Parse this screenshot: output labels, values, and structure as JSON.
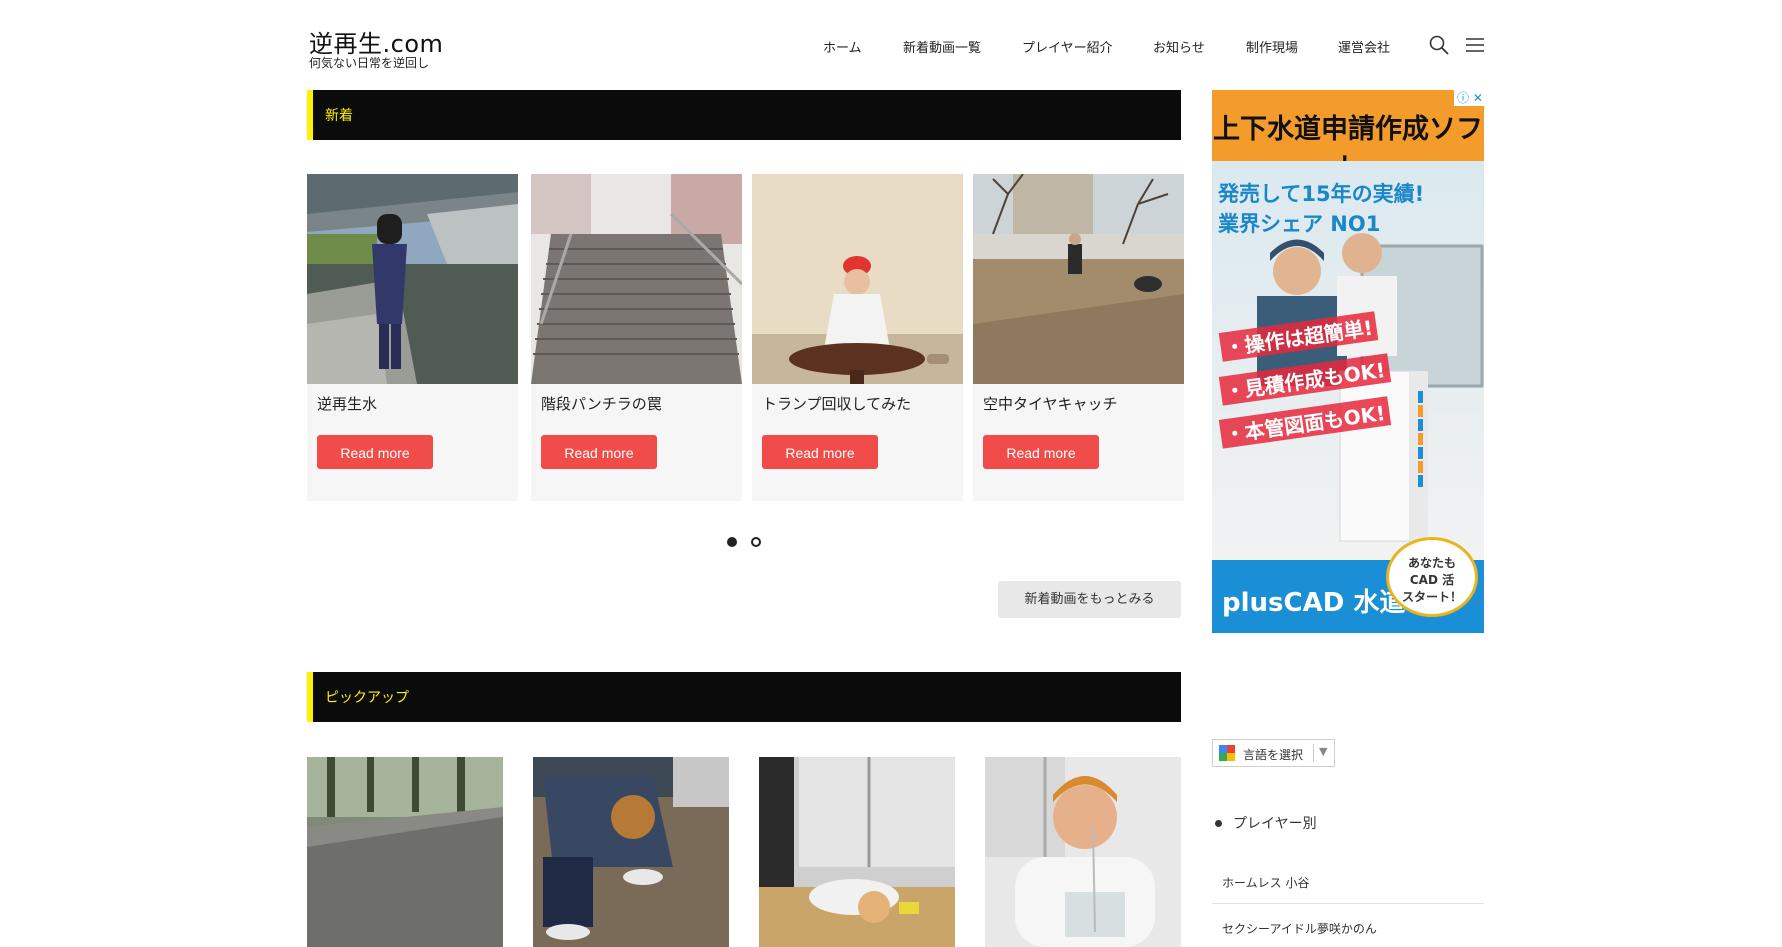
{
  "site": {
    "title": "逆再生.com",
    "tagline": "何気ない日常を逆回し"
  },
  "nav": {
    "items": [
      "ホーム",
      "新着動画一覧",
      "プレイヤー紹介",
      "お知らせ",
      "制作現場",
      "運営会社"
    ],
    "search_icon": "search-icon",
    "menu_icon": "hamburger-menu-icon"
  },
  "sections": {
    "new": {
      "label": "新着"
    },
    "pickup": {
      "label": "ピックアップ"
    }
  },
  "new_videos": [
    {
      "title": "逆再生水",
      "button": "Read more"
    },
    {
      "title": "階段パンチラの罠",
      "button": "Read more"
    },
    {
      "title": "トランプ回収してみた",
      "button": "Read more"
    },
    {
      "title": "空中タイヤキャッチ",
      "button": "Read more"
    }
  ],
  "carousel": {
    "pages": 2,
    "active_page": 1
  },
  "more_button": "新着動画をもっとみる",
  "ad": {
    "header": "上下水道申請作成ソフト",
    "claim_line1": "発売して15年の実績!",
    "claim_line2": "業界シェア NO1",
    "bullets": [
      "・操作は超簡単!",
      "・見積作成もOK!",
      "・本管図面もOK!"
    ],
    "brand": "plusCAD 水道",
    "bubble": [
      "あなたも",
      "CAD 活",
      "スタート！"
    ],
    "adchoices": "ⓘ ✕"
  },
  "translate": {
    "label": "言語を選択",
    "caret": "▼"
  },
  "players_widget": {
    "title": "プレイヤー別",
    "items": [
      "ホームレス 小谷",
      "セクシーアイドル夢咲かのん"
    ]
  },
  "colors": {
    "section_bar_bg": "#0b0b0b",
    "section_bar_accent": "#fff200",
    "read_more_bg": "#f04d4a",
    "ad_orange": "#f39b2b",
    "ad_blue": "#1a8fd6"
  }
}
